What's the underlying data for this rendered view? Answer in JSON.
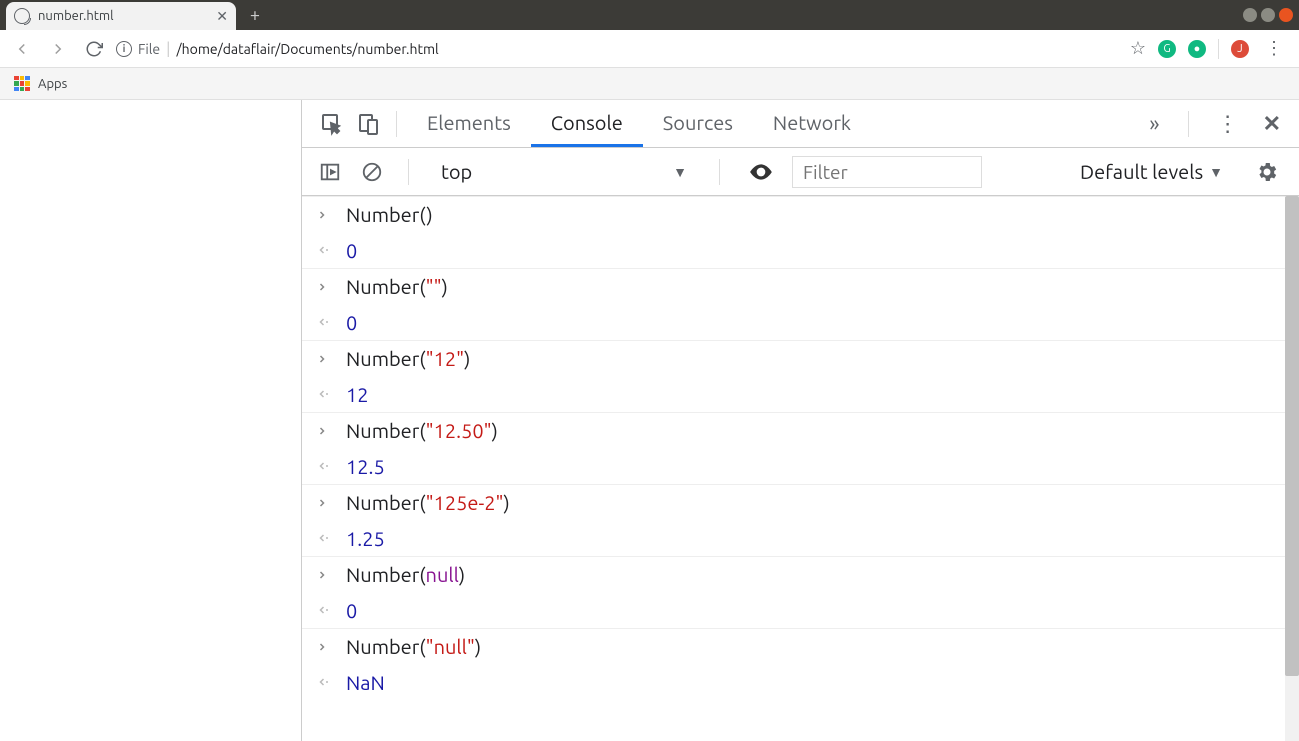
{
  "tab": {
    "title": "number.html"
  },
  "url": {
    "scheme": "File",
    "path": "/home/dataflair/Documents/number.html"
  },
  "bookmarks": {
    "apps": "Apps"
  },
  "devtools": {
    "tabs": {
      "elements": "Elements",
      "console": "Console",
      "sources": "Sources",
      "network": "Network"
    },
    "more_glyph": "»"
  },
  "console_toolbar": {
    "context": "top",
    "filter_placeholder": "Filter",
    "levels": "Default levels"
  },
  "log": [
    {
      "type": "input",
      "prefix": "Number(",
      "arg_text": "",
      "arg_class": "",
      "suffix": ")"
    },
    {
      "type": "output",
      "value": "0",
      "class": "tok-num"
    },
    {
      "type": "input",
      "prefix": "Number(",
      "arg_text": "\"\"",
      "arg_class": "tok-str",
      "suffix": ")"
    },
    {
      "type": "output",
      "value": "0",
      "class": "tok-num"
    },
    {
      "type": "input",
      "prefix": "Number(",
      "arg_text": "\"12\"",
      "arg_class": "tok-str",
      "suffix": ")"
    },
    {
      "type": "output",
      "value": "12",
      "class": "tok-num"
    },
    {
      "type": "input",
      "prefix": "Number(",
      "arg_text": "\"12.50\"",
      "arg_class": "tok-str",
      "suffix": ")"
    },
    {
      "type": "output",
      "value": "12.5",
      "class": "tok-num"
    },
    {
      "type": "input",
      "prefix": "Number(",
      "arg_text": "\"125e-2\"",
      "arg_class": "tok-str",
      "suffix": ")"
    },
    {
      "type": "output",
      "value": "1.25",
      "class": "tok-num"
    },
    {
      "type": "input",
      "prefix": "Number(",
      "arg_text": "null",
      "arg_class": "tok-null",
      "suffix": ")"
    },
    {
      "type": "output",
      "value": "0",
      "class": "tok-num"
    },
    {
      "type": "input",
      "prefix": "Number(",
      "arg_text": "\"null\"",
      "arg_class": "tok-str",
      "suffix": ")"
    },
    {
      "type": "output",
      "value": "NaN",
      "class": "tok-num"
    }
  ]
}
